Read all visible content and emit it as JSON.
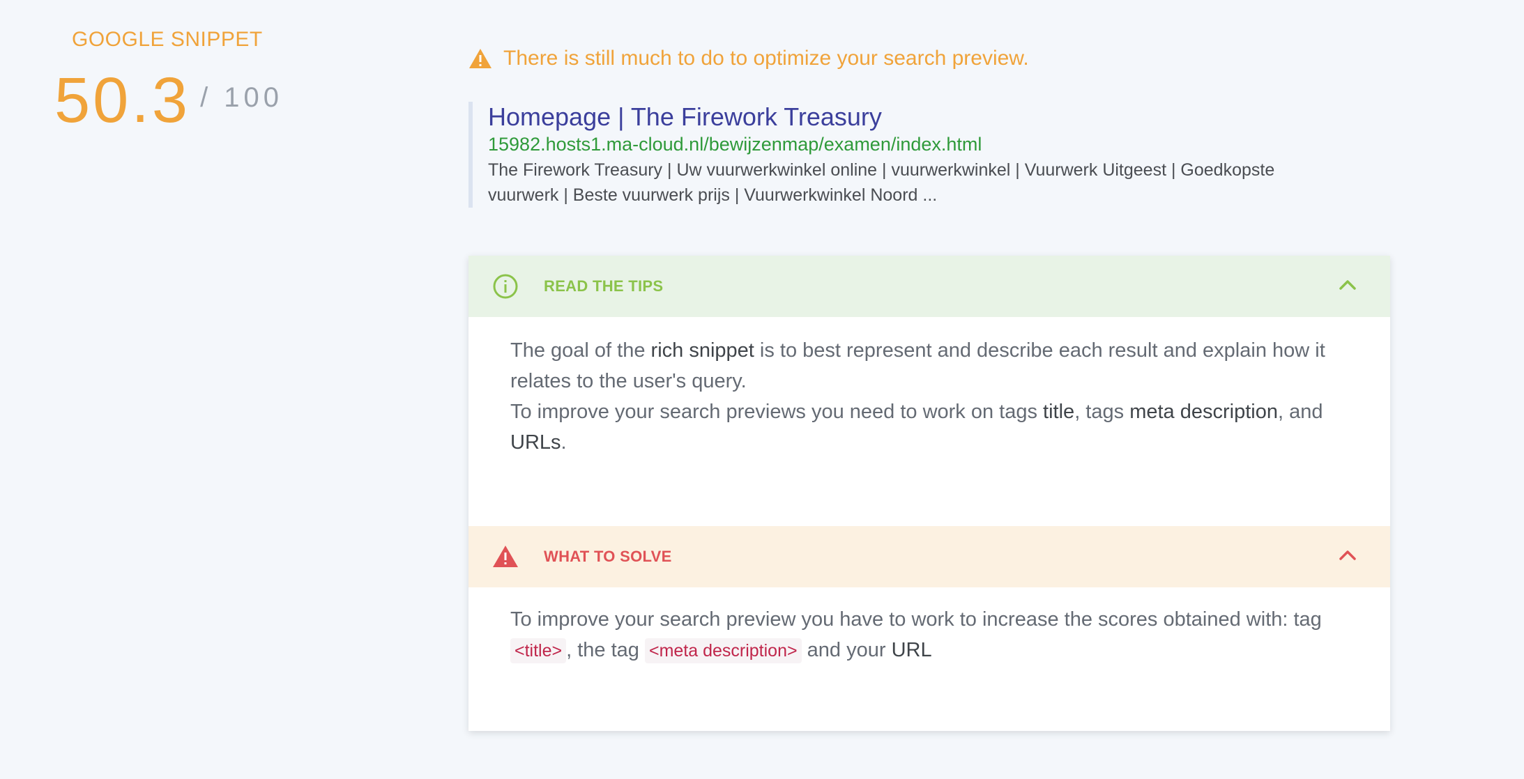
{
  "score": {
    "title": "GOOGLE SNIPPET",
    "value": "50.3",
    "max": "/ 100",
    "accent_color": "#f0a33a"
  },
  "warning": {
    "icon": "warning-triangle-icon",
    "text": "There is still much to do to optimize your search preview."
  },
  "preview": {
    "title": "Homepage | The Firework Treasury",
    "url": "15982.hosts1.ma-cloud.nl/bewijzenmap/examen/index.html",
    "description": "The Firework Treasury | Uw vuurwerkwinkel online | vuurwerkwinkel | Vuurwerk Uitgeest | Goedkopste vuurwerk | Beste vuurwerk prijs | Vuurwerkwinkel Noord ..."
  },
  "tips": {
    "icon": "info-circle-icon",
    "label": "READ THE TIPS",
    "p1_a": "The goal of the ",
    "p1_b": "rich snippet",
    "p1_c": " is to best represent and describe each result and explain how it relates to the user's query.",
    "p2_a": "To improve your search previews you need to work on tags ",
    "p2_b": "title",
    "p2_c": ", tags ",
    "p2_d": "meta description",
    "p2_e": ", and ",
    "p2_f": "URLs",
    "p2_g": "."
  },
  "solve": {
    "icon": "alert-triangle-icon",
    "label": "WHAT TO SOLVE",
    "t_a": "To improve your search preview you have to work to increase the scores obtained with: tag ",
    "tag1": "<title>",
    "t_b": ", the tag ",
    "tag2": "<meta description>",
    "t_c": " and your ",
    "t_d": "URL"
  }
}
